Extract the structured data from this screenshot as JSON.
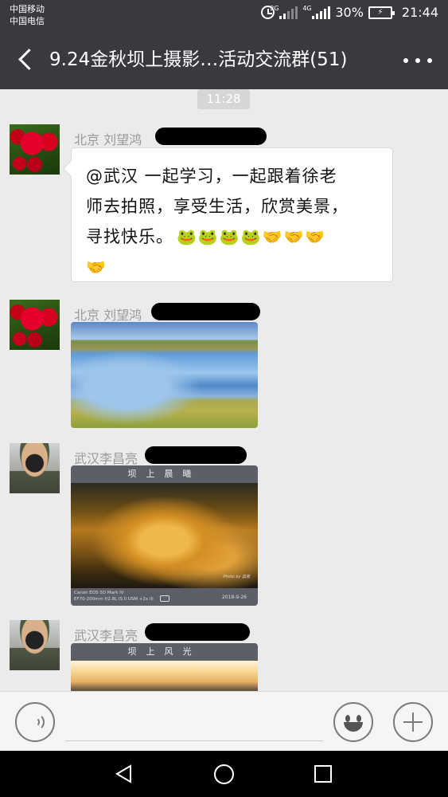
{
  "status_bar": {
    "carrier_1": "中国移动",
    "carrier_2": "中国电信",
    "net_2g": "2G",
    "net_4g": "4G",
    "battery": "30%",
    "time": "21:44"
  },
  "header": {
    "title": "9.24金秋坝上摄影…活动交流群(51)"
  },
  "chat": {
    "timestamp": "11:28",
    "messages": [
      {
        "sender": "北京  刘望鸿",
        "text_line_1": "@武汉  一起学习，一起跟着徐老",
        "text_line_2": "师去拍照，享受生活，欣赏美景，",
        "text_line_3": "寻找快乐。",
        "emoji_row_1": "🐸🐸🐸🐸🤝🤝🤝",
        "emoji_row_2": "🤝"
      },
      {
        "sender": "北京  刘望鸿"
      },
      {
        "sender": "武汉李昌亮",
        "photo_title": "坝上晨曦",
        "photo_camera_line_1": "Canon EOS 5D Mark IV",
        "photo_camera_line_2": "EF70-200mm f/2.8L IS II USM +2x III",
        "photo_date": "2018-9-26",
        "photo_signature": "Photo by 昌亮"
      },
      {
        "sender": "武汉李昌亮",
        "photo_title": "坝上风光"
      }
    ]
  }
}
